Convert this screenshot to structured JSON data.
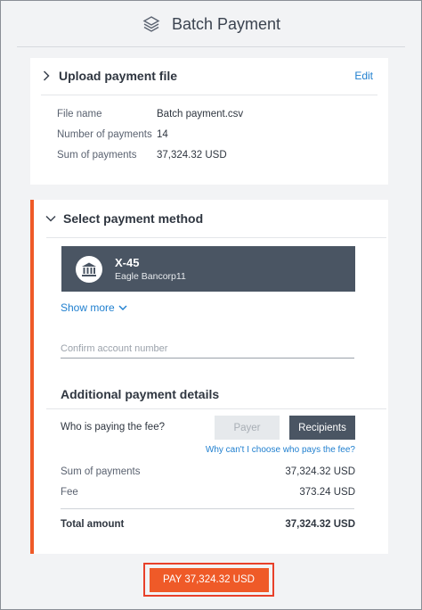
{
  "header": {
    "title": "Batch Payment",
    "icon": "layers-icon"
  },
  "upload": {
    "title": "Upload payment file",
    "edit_label": "Edit",
    "rows": [
      {
        "label": "File name",
        "value": "Batch payment.csv"
      },
      {
        "label": "Number of payments",
        "value": "14"
      },
      {
        "label": "Sum of payments",
        "value": "37,324.32 USD"
      }
    ]
  },
  "method": {
    "title": "Select payment method",
    "account": {
      "name": "X-45",
      "bank": "Eagle Bancorp11",
      "icon": "bank-icon"
    },
    "show_more": "Show more",
    "confirm_placeholder": "Confirm account number",
    "details_title": "Additional payment details",
    "fee_question": "Who is paying the fee?",
    "payer_label": "Payer",
    "recipients_label": "Recipients",
    "why_link": "Why can't I choose who pays the fee?",
    "sum_label": "Sum of payments",
    "sum_value": "37,324.32 USD",
    "fee_label": "Fee",
    "fee_value": "373.24 USD",
    "total_label": "Total amount",
    "total_value": "37,324.32 USD"
  },
  "pay_button": "PAY 37,324.32 USD",
  "colors": {
    "accent": "#ef5a28",
    "link": "#1f7fcf",
    "dark": "#4a5563"
  }
}
